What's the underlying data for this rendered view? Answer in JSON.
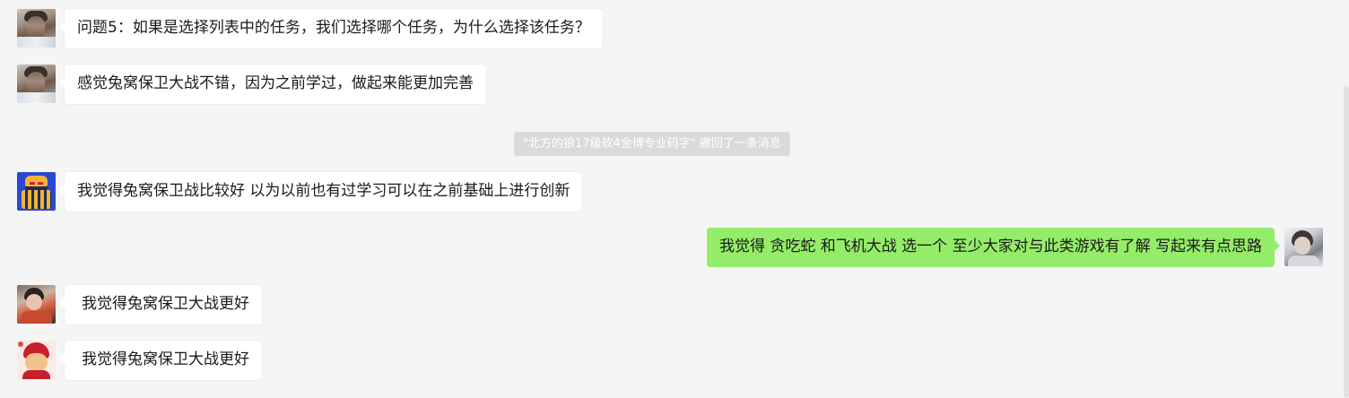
{
  "chat": {
    "system_notice": "\"北方的狼17级软4金博专业码字\" 撤回了一条消息",
    "messages": [
      {
        "side": "left",
        "avatar_icon": "user-avatar-photo-man",
        "text": "问题5：如果是选择列表中的任务，我们选择哪个任务，为什么选择该任务？"
      },
      {
        "side": "left",
        "avatar_icon": "user-avatar-photo-man",
        "text": "感觉兔窝保卫大战不错，因为之前学过，做起来能更加完善"
      },
      {
        "side": "left",
        "avatar_icon": "user-avatar-robot",
        "text": "我觉得兔窝保卫战比较好 以为以前也有过学习可以在之前基础上进行创新"
      },
      {
        "side": "right",
        "avatar_icon": "user-avatar-photo-self",
        "text": "我觉得 贪吃蛇 和飞机大战  选一个  至少大家对与此类游戏有了解  写起来有点思路"
      },
      {
        "side": "left",
        "avatar_icon": "user-avatar-photo-kid",
        "text": "我觉得兔窝保卫大战更好"
      },
      {
        "side": "left",
        "avatar_icon": "user-avatar-cat",
        "text": "我觉得兔窝保卫大战更好"
      }
    ]
  },
  "colors": {
    "background": "#f5f5f5",
    "bubble_left": "#ffffff",
    "bubble_right": "#95ec69",
    "system_notice_bg": "#dadada",
    "system_notice_text": "#ffffff",
    "scrollbar_thumb": "#e1e1e1"
  }
}
